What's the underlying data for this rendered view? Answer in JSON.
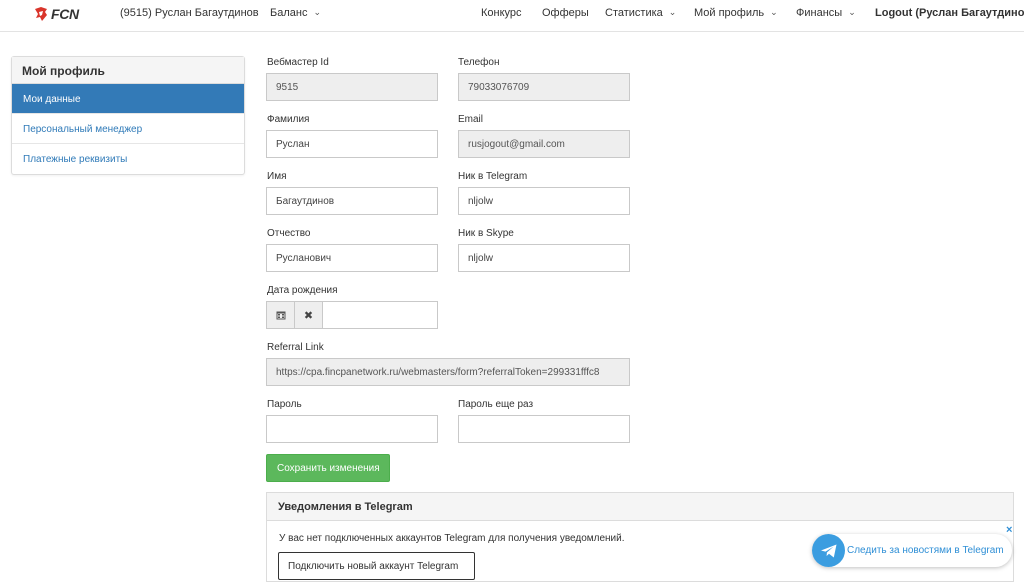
{
  "nav": {
    "logo_text": "FCN",
    "user": "(9515) Руслан Багаутдинов",
    "balance": "Баланс",
    "contest": "Конкурс",
    "offers": "Офферы",
    "stats": "Статистика",
    "profile": "Мой профиль",
    "finance": "Финансы",
    "logout": "Logout (Руслан Багаутдинов)"
  },
  "sidebar": {
    "title": "Мой профиль",
    "items": [
      {
        "label": "Мои данные"
      },
      {
        "label": "Персональный менеджер"
      },
      {
        "label": "Платежные реквизиты"
      }
    ]
  },
  "form": {
    "webmaster_id": {
      "label": "Вебмастер Id",
      "value": "9515"
    },
    "phone": {
      "label": "Телефон",
      "value": "79033076709"
    },
    "last_name": {
      "label": "Фамилия",
      "value": "Руслан"
    },
    "email": {
      "label": "Email",
      "value": "rusjogout@gmail.com"
    },
    "first_name": {
      "label": "Имя",
      "value": "Багаутдинов"
    },
    "telegram": {
      "label": "Ник в Telegram",
      "value": "nljolw"
    },
    "patronymic": {
      "label": "Отчество",
      "value": "Русланович"
    },
    "skype": {
      "label": "Ник в Skype",
      "value": "nljolw"
    },
    "birth_date": {
      "label": "Дата рождения",
      "value": ""
    },
    "referral": {
      "label": "Referral Link",
      "value": "https://cpa.fincpanetwork.ru/webmasters/form?referralToken=299331fffc8"
    },
    "password": {
      "label": "Пароль",
      "value": ""
    },
    "password_repeat": {
      "label": "Пароль еще раз",
      "value": ""
    },
    "save_label": "Сохранить изменения"
  },
  "telegram_panel": {
    "title": "Уведомления в Telegram",
    "text": "У вас нет подключенных аккаунтов Telegram для получения уведомлений.",
    "connect_label": "Подключить новый аккаунт Telegram"
  },
  "tg_widget": {
    "label": "Следить за новостями в Telegram",
    "close": "×"
  },
  "colors": {
    "accent": "#337ab7",
    "save": "#5cb85c",
    "telegram": "#3b9de0"
  }
}
